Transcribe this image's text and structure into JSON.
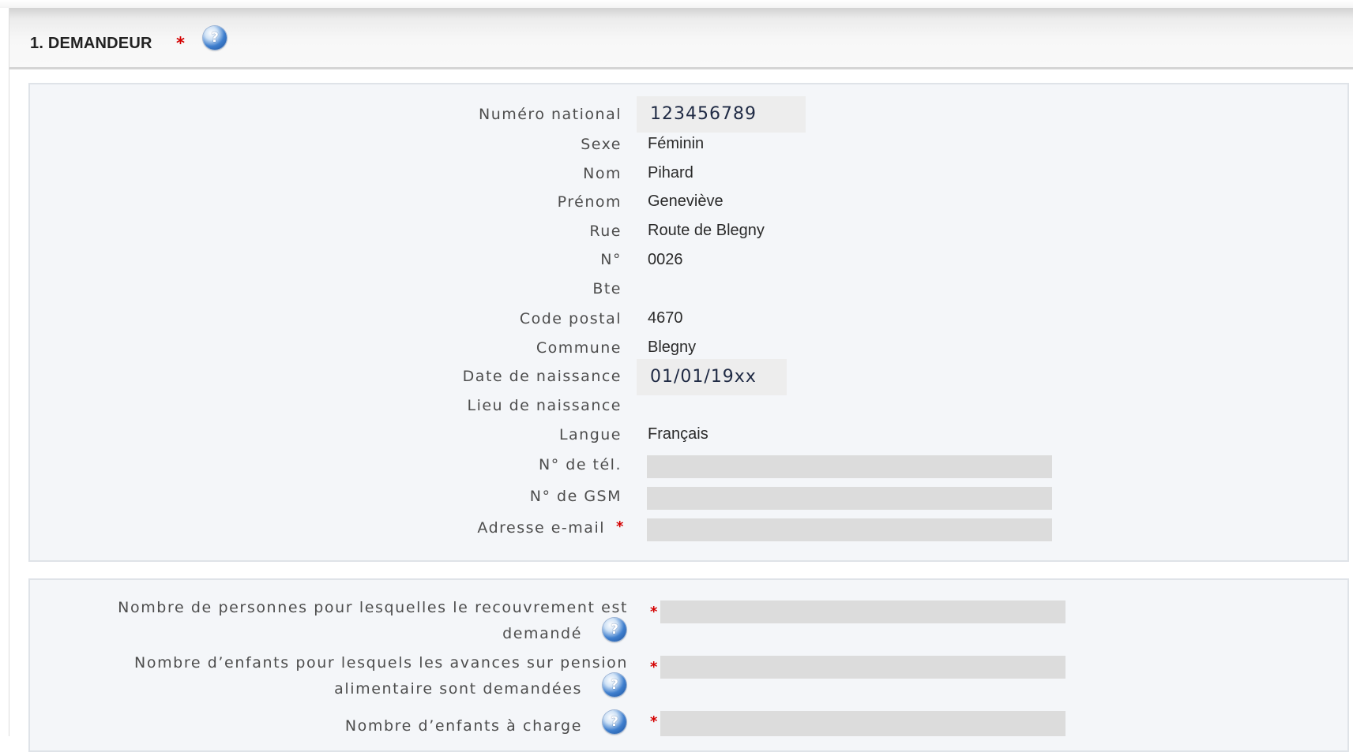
{
  "section": {
    "title": "1. DEMANDEUR",
    "required_mark": "*",
    "help_icon": "help-icon"
  },
  "applicant": {
    "national_number": {
      "label": "Numéro national",
      "value": "123456789"
    },
    "sex": {
      "label": "Sexe",
      "value": "Féminin"
    },
    "last_name": {
      "label": "Nom",
      "value": "Pihard"
    },
    "first_name": {
      "label": "Prénom",
      "value": "Geneviève"
    },
    "street": {
      "label": "Rue",
      "value": "Route de Blegny"
    },
    "number": {
      "label": "N°",
      "value": "0026"
    },
    "box": {
      "label": "Bte",
      "value": ""
    },
    "postal_code": {
      "label": "Code postal",
      "value": "4670"
    },
    "municipality": {
      "label": "Commune",
      "value": "Blegny"
    },
    "birth_date": {
      "label": "Date de naissance",
      "value": "01/01/19xx"
    },
    "birth_place": {
      "label": "Lieu de naissance",
      "value": ""
    },
    "language": {
      "label": "Langue",
      "value": "Français"
    },
    "phone": {
      "label": "N° de tél.",
      "value": ""
    },
    "gsm": {
      "label": "N° de GSM",
      "value": ""
    },
    "email": {
      "label": "Adresse e-mail",
      "value": "",
      "required_mark": "*"
    }
  },
  "recovery": {
    "persons_count": {
      "label_line1": "Nombre de personnes pour lesquelles le recouvrement est",
      "label_line2": "demandé",
      "value": "",
      "required_mark": "*"
    },
    "children_advances": {
      "label_line1": "Nombre d’enfants pour lesquels les avances sur pension",
      "label_line2": "alimentaire sont demandées",
      "value": "",
      "required_mark": "*"
    },
    "dependent_children": {
      "label": "Nombre d’enfants à charge",
      "value": "",
      "required_mark": "*"
    }
  },
  "colors": {
    "required": "#d40000",
    "panel_bg": "#f4f6f9",
    "input_bg": "#dcdcdc",
    "help_blue": "#2f6cc0"
  }
}
